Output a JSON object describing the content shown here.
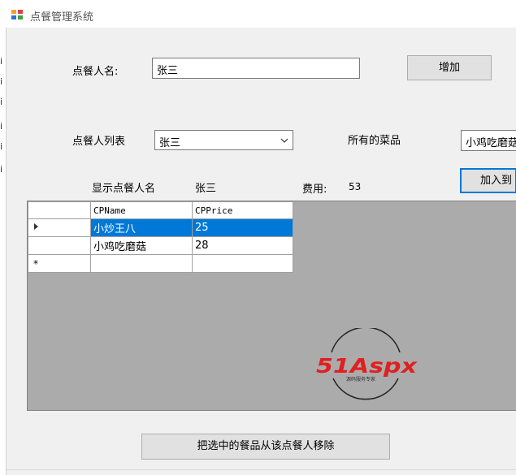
{
  "window": {
    "title": "点餐管理系统"
  },
  "edge_glyphs": [
    "i",
    "i",
    "i",
    "i",
    "i",
    "i"
  ],
  "form": {
    "name_label": "点餐人名:",
    "name_input_value": "张三",
    "add_button": "增加",
    "diner_list_label": "点餐人列表",
    "diner_combo_value": "张三",
    "all_dishes_label": "所有的菜品",
    "dish_combo_value": "小鸡吃磨菇",
    "add_to_button": "加入到",
    "show_name_label": "显示点餐人名",
    "show_name_value": "张三",
    "cost_label": "费用:",
    "cost_value": "53",
    "remove_button": "把选中的餐品从该点餐人移除"
  },
  "grid": {
    "columns": [
      "CPName",
      "CPPrice"
    ],
    "rows": [
      {
        "marker": "▶",
        "CPName": "小炒王八",
        "CPPrice": "25",
        "selected": true
      },
      {
        "marker": "",
        "CPName": "小鸡吃磨菇",
        "CPPrice": "28",
        "selected": false
      },
      {
        "marker": "*",
        "CPName": "",
        "CPPrice": "",
        "selected": false
      }
    ]
  },
  "watermark": {
    "brand": "51Aspx",
    "tagline": "源码服务专家"
  },
  "colors": {
    "selection": "#0078d7",
    "grid_background": "#ababab",
    "logo_red": "#e02020",
    "logo_green": "#1a9b3a"
  }
}
